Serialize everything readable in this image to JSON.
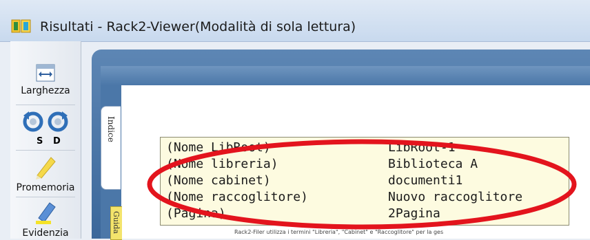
{
  "window": {
    "title": "Risultati - Rack2-Viewer(Modalità di sola lettura)"
  },
  "toolbar": {
    "width_label": "Larghezza",
    "rotate_left_label": "S",
    "rotate_right_label": "D",
    "memo_label": "Promemoria",
    "highlight_label": "Evidenzia"
  },
  "tabs": {
    "index_label": "Indice",
    "guide_label": "Guida"
  },
  "info": {
    "rows": [
      {
        "key": "(Nome LibRoot)",
        "value": "LibRoot-1"
      },
      {
        "key": "(Nome libreria)",
        "value": "Biblioteca A"
      },
      {
        "key": "(Nome cabinet)",
        "value": "documenti1"
      },
      {
        "key": "(Nome raccoglitore)",
        "value": "Nuovo raccoglitore"
      },
      {
        "key": "(Pagina)",
        "value": "2Pagina"
      }
    ]
  },
  "footer_note": "Rack2-Filer utilizza i termini \"Libreria\", \"Cabinet\" e \"Raccoglitore\" per la ges",
  "colors": {
    "annotation": "#e3141d",
    "frame": "#4b77a8",
    "info_bg": "#fdfbe0"
  }
}
